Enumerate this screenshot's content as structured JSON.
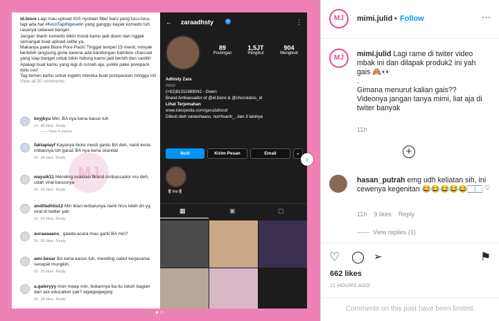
{
  "post_media": {
    "caption": {
      "author": "id.biore",
      "text": "Lagi mau upload IGS nyobain filter baru yang lucu-lucu, tapi ada hal",
      "hashtag": "#KecilTapiNgeselin",
      "text2": "yang ganggu kayak komedo tuh rasanya sebeeel banget.",
      "text3": "Jangan biarin komedo bikin mood kamu jadi down dan nggak semangat buat upload selfie ya.",
      "text4": "Makanya pake Biore Pore Pack! Tinggal tempel 15 menit, minyak berlebih langsung gone karena ada kandungan bamboo charcoal yang siap banget untuk bikin hidung kamu jadi bersih dan cantik!",
      "text5": "Apalagi buat kamu yang lagi di rumah aja, yukkk pake porepack dulu cus!",
      "text6": "Tag temen kamu untuk ingetin mereka buat porepackan minggu ini!",
      "view_all": "View all 50 comments"
    },
    "comments": [
      {
        "user": "keyjkyu",
        "text": "Min, BA nya kena kasus tuh",
        "time": "1h",
        "likes": "48 likes",
        "reply": "Reply"
      },
      {
        "user": "faktaplayf",
        "text": "Kayanya biore mesti gantu BA deh, nanti kena imbasnya loh gara2 BA nya kena skandal",
        "time": "1h",
        "likes": "28 likes",
        "reply": "Reply"
      },
      {
        "user": "wayuik11",
        "text": "Mending evaluasi Brand Ambassador mu deh, udah viral kasusnya",
        "time": "1h",
        "likes": "29 likes",
        "reply": "Reply"
      },
      {
        "user": "andifadhila12",
        "text": "Min iklan terbarunya nanti hrus lebih dri yg viral di twitter yah",
        "time": "1h",
        "likes": "25 likes",
        "reply": "Reply"
      },
      {
        "user": "auraaaaans_",
        "text": "gaada acara mau ganti BA min?",
        "time": "1h",
        "likes": "36 likes",
        "reply": "Reply"
      },
      {
        "user": "amr.besar",
        "text": "BA kena kasus tuh, mending cabut kerjasama secepat mungkin.",
        "time": "1h",
        "likes": "25 likes",
        "reply": "Reply"
      },
      {
        "user": "a.galeryyy",
        "text": "mon maap min, bukannya ba itu tokoh bagian dari sex education yak? wgwgwgwgwg",
        "time": "1h",
        "likes": "18 likes",
        "reply": "Reply"
      }
    ],
    "view_replies": "View 4 replies",
    "watermark": "MJ",
    "profile": {
      "username": "zaraadhsty",
      "posts": "89",
      "posts_label": "Postingan",
      "followers": "1,5JT",
      "followers_label": "Pengikut",
      "following": "904",
      "following_label": "Mengikuti",
      "name": "Adhisty Zara",
      "category": "Aktor",
      "phone": "(+62)81311889042 - Gwen",
      "bio1": "Brand Ambassador of @id.biore & @chocolatos_id",
      "translate": "Lihat Terjemahan",
      "link": "www.tokopedia.com/garudafood/",
      "followed_by": "Diikuti oleh vaneshaass, nurrhsanh_, dan 3 lainnya",
      "btn_follow": "Ikuti",
      "btn_message": "Kirim Pesan",
      "btn_email": "Email",
      "highlight_label": "me"
    },
    "grid_colors": [
      "#4a4a4a",
      "#c9a98a",
      "#3a2f4f",
      "#b8a79b",
      "#d9b8c6",
      "#1c1c1c",
      "#a996c4",
      "#8d6e7e",
      "#6f6f6f"
    ]
  },
  "sidebar": {
    "account": "mimi.julid",
    "logo_text": "MJ",
    "dot": "•",
    "follow": "Follow",
    "more": "···",
    "caption_user": "mimi.julid",
    "caption": "Lagi rame di twiter video mbak ini dan dilapak produk2 ini yah gais 🙈👀",
    "caption_dot": ".",
    "caption2": "Gimana menurut kalian gais?? Videonya jangan tanya mimi, liat aja di twiter banyak",
    "caption_time": "11h",
    "comment_user": "hasan_putrah",
    "comment_text": "emg udh keliatan sih, ini cewenya kegenitan 😂😂😂😂😂🏻🏻",
    "comment_time": "11h",
    "comment_likes": "9 likes",
    "comment_reply": "Reply",
    "view_replies": "View replies (1)",
    "likes": "662 likes",
    "time_ago": "11 HOURS AGO",
    "comments_closed": "Comments on this post have been limited."
  }
}
